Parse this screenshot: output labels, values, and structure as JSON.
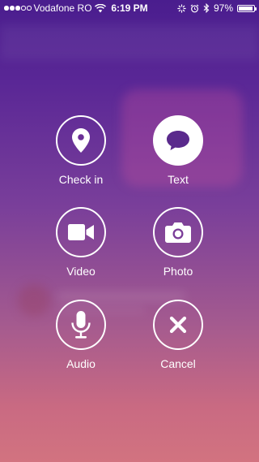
{
  "status_bar": {
    "carrier": "Vodafone RO",
    "time": "6:19 PM",
    "battery_percent": "97%",
    "battery_level": 0.97,
    "signal_bars_filled": 3,
    "signal_bars_total": 5
  },
  "actions": [
    {
      "label": "Check in",
      "icon": "location-pin-icon",
      "filled": false
    },
    {
      "label": "Text",
      "icon": "speech-bubble-icon",
      "filled": true
    },
    {
      "label": "Video",
      "icon": "video-camera-icon",
      "filled": false
    },
    {
      "label": "Photo",
      "icon": "camera-icon",
      "filled": false
    },
    {
      "label": "Audio",
      "icon": "microphone-icon",
      "filled": false
    },
    {
      "label": "Cancel",
      "icon": "close-icon",
      "filled": false
    }
  ],
  "colors": {
    "background_top": "#4a1d8e",
    "background_bottom": "#d27380",
    "icon_on_filled": "#5a2a8c",
    "foreground": "#ffffff"
  }
}
